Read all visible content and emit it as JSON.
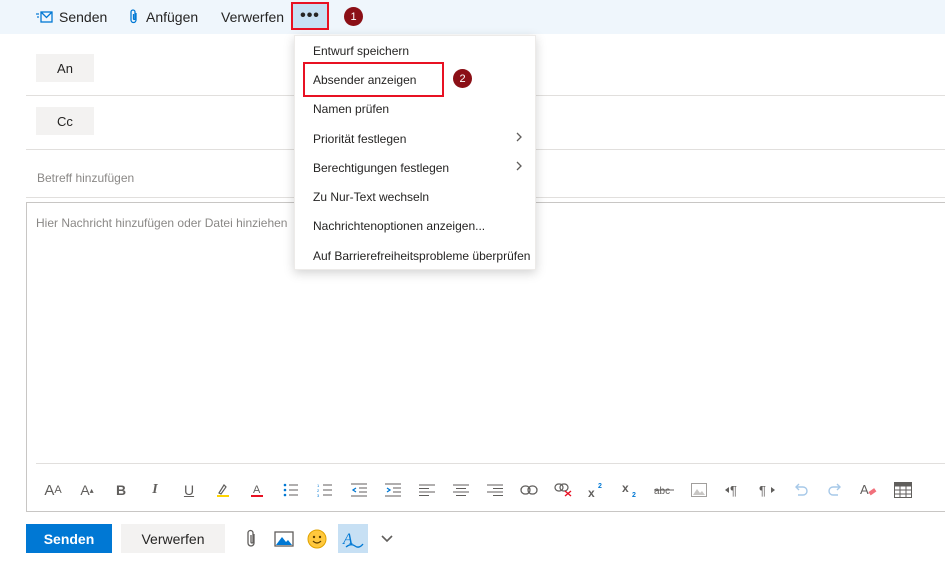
{
  "toolbar": {
    "send_label": "Senden",
    "attach_label": "Anfügen",
    "discard_label": "Verwerfen",
    "more_label": "•••",
    "step1": "1"
  },
  "recipients": {
    "to_label": "An",
    "cc_label": "Cc"
  },
  "subject": {
    "placeholder": "Betreff hinzufügen"
  },
  "body": {
    "placeholder": "Hier Nachricht hinzufügen oder Datei hinziehen"
  },
  "menu": {
    "items": [
      {
        "label": "Entwurf speichern"
      },
      {
        "label": "Absender anzeigen"
      },
      {
        "label": "Namen prüfen"
      },
      {
        "label": "Priorität festlegen",
        "submenu": true
      },
      {
        "label": "Berechtigungen festlegen",
        "submenu": true
      },
      {
        "label": "Zu Nur-Text wechseln"
      },
      {
        "label": "Nachrichtenoptionen anzeigen..."
      },
      {
        "label": "Auf Barrierefreiheitsprobleme überprüfen"
      }
    ],
    "step2": "2"
  },
  "footer": {
    "send_label": "Senden",
    "discard_label": "Verwerfen"
  },
  "format_icons": [
    "font-size-icon",
    "grow-font-icon",
    "bold-icon",
    "italic-icon",
    "underline-icon",
    "highlight-icon",
    "font-color-icon",
    "bullets-icon",
    "numbering-icon",
    "decrease-indent-icon",
    "increase-indent-icon",
    "align-left-icon",
    "align-center-icon",
    "align-right-icon",
    "link-icon",
    "remove-link-icon",
    "superscript-icon",
    "subscript-icon",
    "strikethrough-icon",
    "image-inline-icon",
    "ltr-icon",
    "rtl-icon",
    "undo-icon",
    "redo-icon",
    "clear-format-icon",
    "table-icon"
  ],
  "colors": {
    "accent": "#0078d4",
    "highlight_box": "#e81123",
    "badge": "#8b0f16"
  }
}
